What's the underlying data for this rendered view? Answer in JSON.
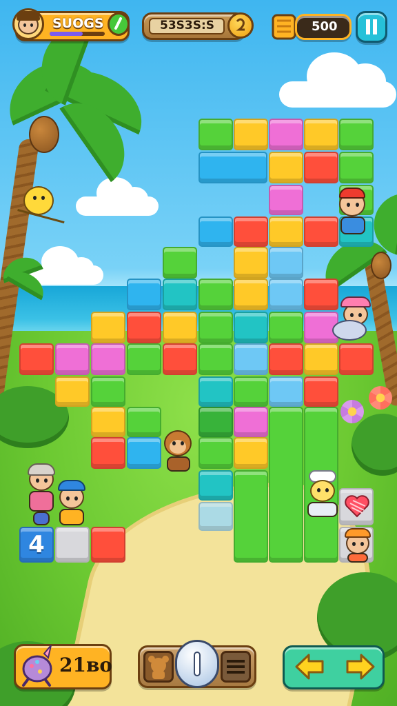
{
  "hud": {
    "player_name": "SUOGS",
    "score_text": "53S3S:S",
    "coins": "500",
    "pause_icon": "pause-icon",
    "level_badge": "4",
    "moves_text": "21вo",
    "colors": {
      "hud_gold": "#ffb323",
      "hud_border": "#6b3f10",
      "hud_teal": "#26c1d9",
      "arrow_yellow": "#ffd21f",
      "sky": "#3fb6f0",
      "grass": "#6cc932"
    }
  },
  "bottom_bar": {
    "left_icon": "toy-icon",
    "center_left_icon": "bear-icon",
    "center_icon": "toggle-knob-icon",
    "center_right_icon": "menu-lines-icon",
    "left_arrow_icon": "arrow-left-icon",
    "right_arrow_icon": "arrow-right-icon"
  }
}
